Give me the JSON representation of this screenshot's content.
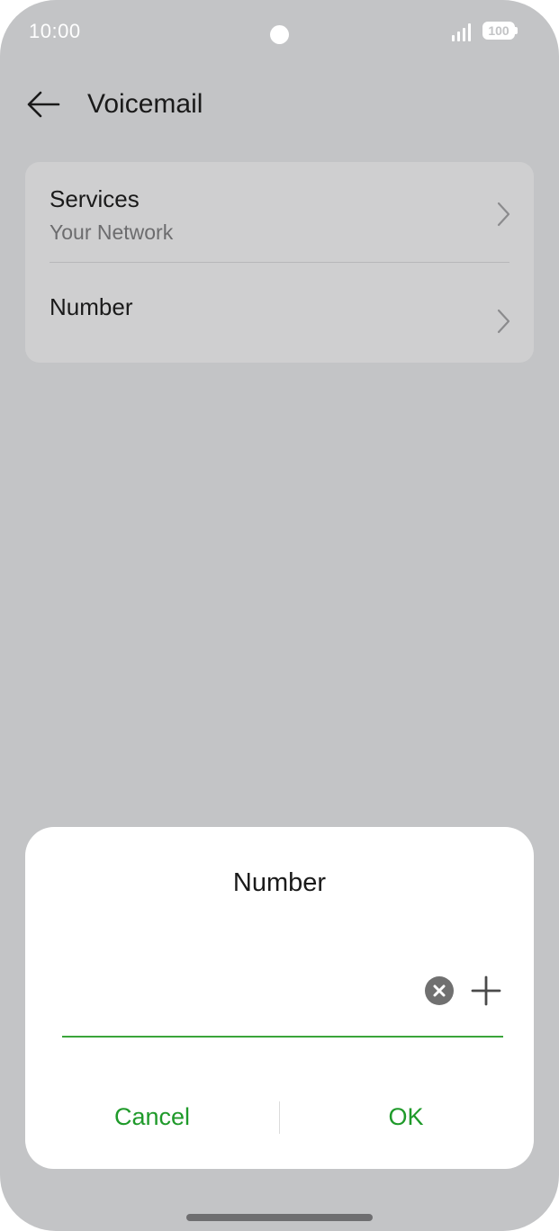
{
  "status_bar": {
    "time": "10:00",
    "battery": "100"
  },
  "app_bar": {
    "title": "Voicemail"
  },
  "settings": {
    "services": {
      "title": "Services",
      "subtitle": "Your Network"
    },
    "number": {
      "title": "Number"
    }
  },
  "dialog": {
    "title": "Number",
    "input_value": "",
    "cancel_label": "Cancel",
    "ok_label": "OK"
  },
  "colors": {
    "accent": "#1f9a2a",
    "background": "#c3c4c6",
    "card": "#cfcfd0"
  }
}
